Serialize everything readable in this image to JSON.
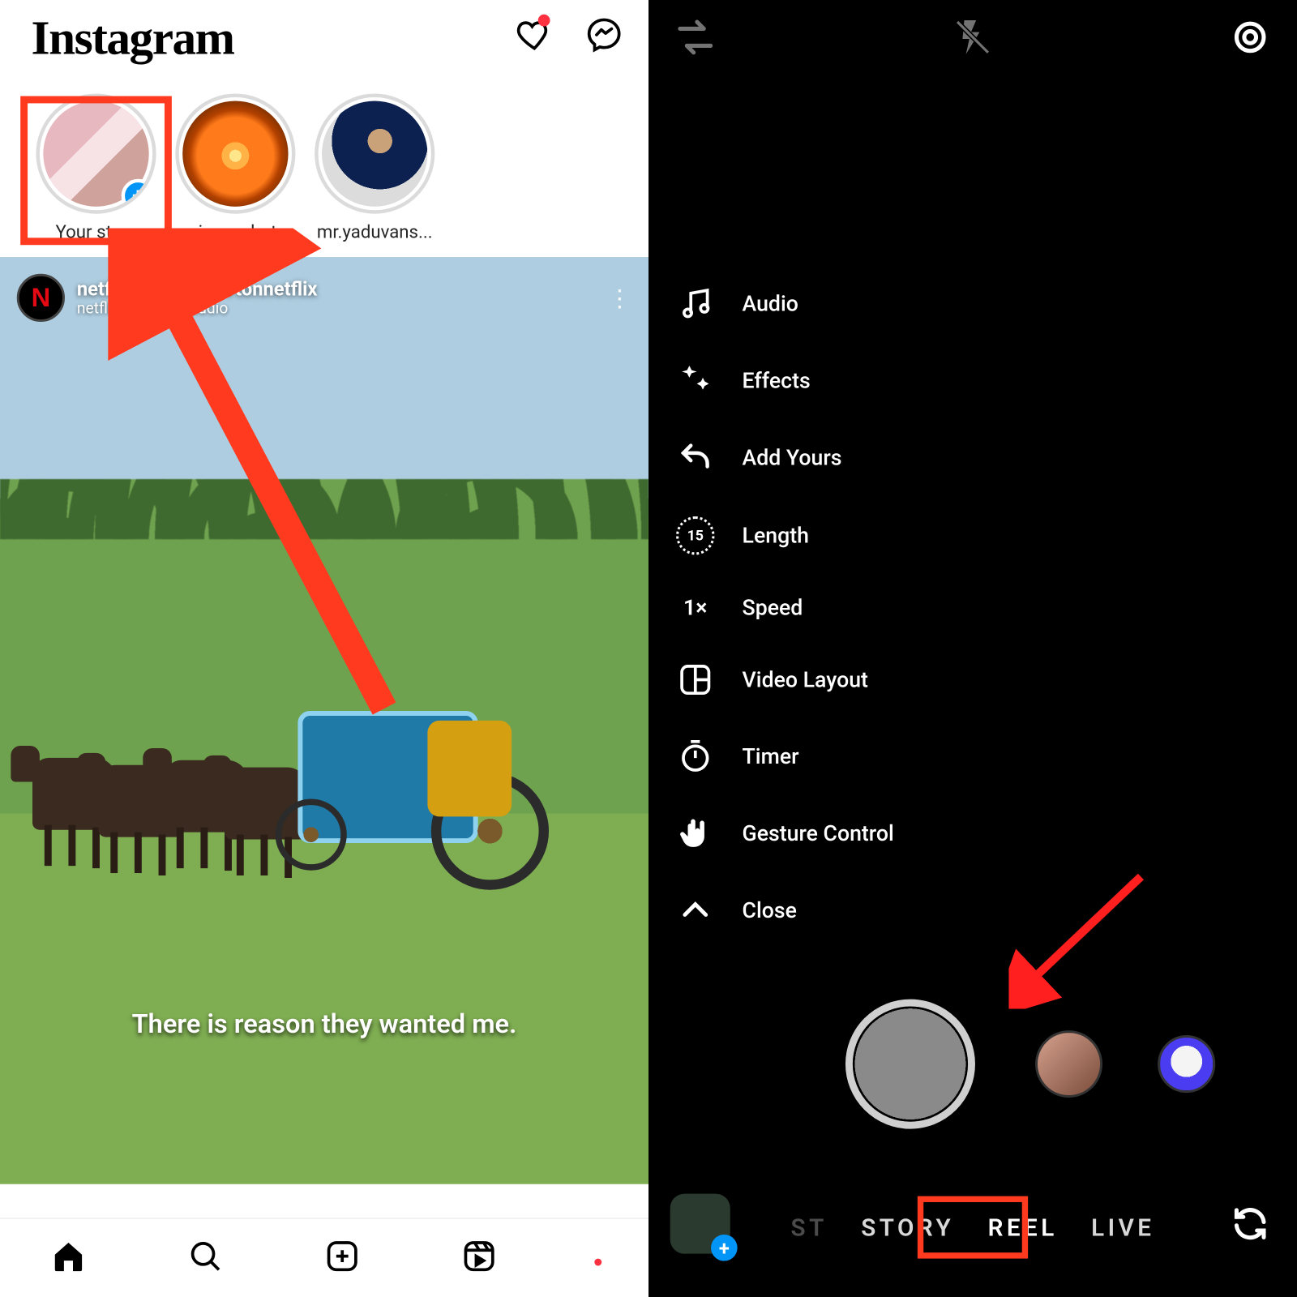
{
  "left": {
    "header": {
      "logo": "Instagram"
    },
    "stories": [
      {
        "name": "Your story"
      },
      {
        "name": "ssiaga_phot..."
      },
      {
        "name": "mr.yaduvans..."
      }
    ],
    "post": {
      "title": "netflix and bridgertonnetflix",
      "subtitle": "netflix • Original audio",
      "avatar_letter": "N",
      "caption": "There is reason they wanted me."
    },
    "nav": [
      "home",
      "search",
      "create",
      "reels",
      "profile"
    ]
  },
  "right": {
    "tools": {
      "audio": "Audio",
      "effects": "Effects",
      "add_yours": "Add Yours",
      "length_label": "Length",
      "length_value": "15",
      "speed_label": "Speed",
      "speed_value": "1×",
      "video_layout": "Video Layout",
      "timer": "Timer",
      "gesture": "Gesture Control",
      "close": "Close"
    },
    "modes": {
      "post_partial": "ST",
      "story": "STORY",
      "reel": "REEL",
      "live": "LIVE"
    }
  }
}
